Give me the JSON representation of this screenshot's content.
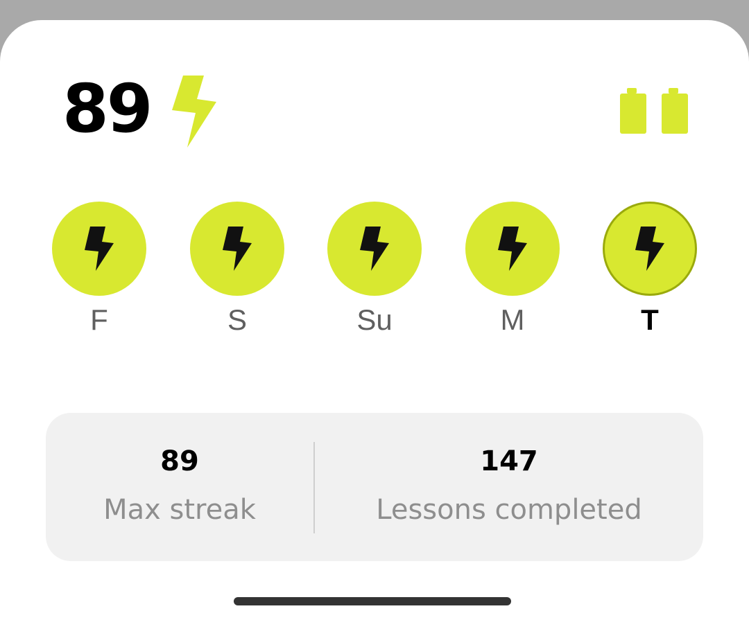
{
  "streak": {
    "count": "89",
    "icon": "lightning-bolt-icon",
    "freezes_icon": "streak-freeze-icon",
    "accent_color": "#d8e830"
  },
  "days": [
    {
      "label": "F",
      "completed": true,
      "today": false,
      "icon": "lightning-bolt-icon"
    },
    {
      "label": "S",
      "completed": true,
      "today": false,
      "icon": "lightning-bolt-icon"
    },
    {
      "label": "Su",
      "completed": true,
      "today": false,
      "icon": "lightning-bolt-icon"
    },
    {
      "label": "M",
      "completed": true,
      "today": false,
      "icon": "lightning-bolt-icon"
    },
    {
      "label": "T",
      "completed": true,
      "today": true,
      "icon": "lightning-bolt-icon"
    }
  ],
  "stats": {
    "max_streak": {
      "value": "89",
      "label": "Max streak"
    },
    "lessons_completed": {
      "value": "147",
      "label": "Lessons completed"
    }
  }
}
